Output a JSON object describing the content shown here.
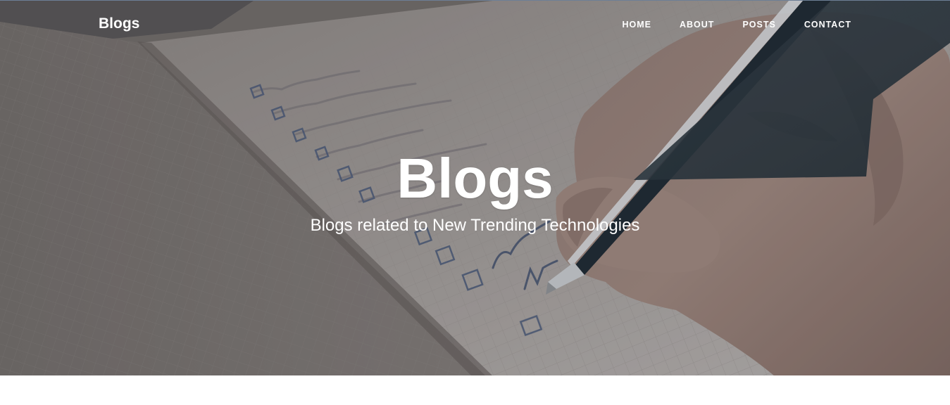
{
  "navbar": {
    "brand": "Blogs",
    "links": [
      {
        "label": "HOME"
      },
      {
        "label": "ABOUT"
      },
      {
        "label": "POSTS"
      },
      {
        "label": "CONTACT"
      }
    ]
  },
  "hero": {
    "title": "Blogs",
    "subtitle": "Blogs related to New Trending Technologies"
  },
  "colors": {
    "text": "#ffffff",
    "hero_tint": "#7d7774",
    "top_border": "#6d7f96",
    "page_background": "#ffffff"
  },
  "icons": [
    "notebook-pen-photo"
  ]
}
